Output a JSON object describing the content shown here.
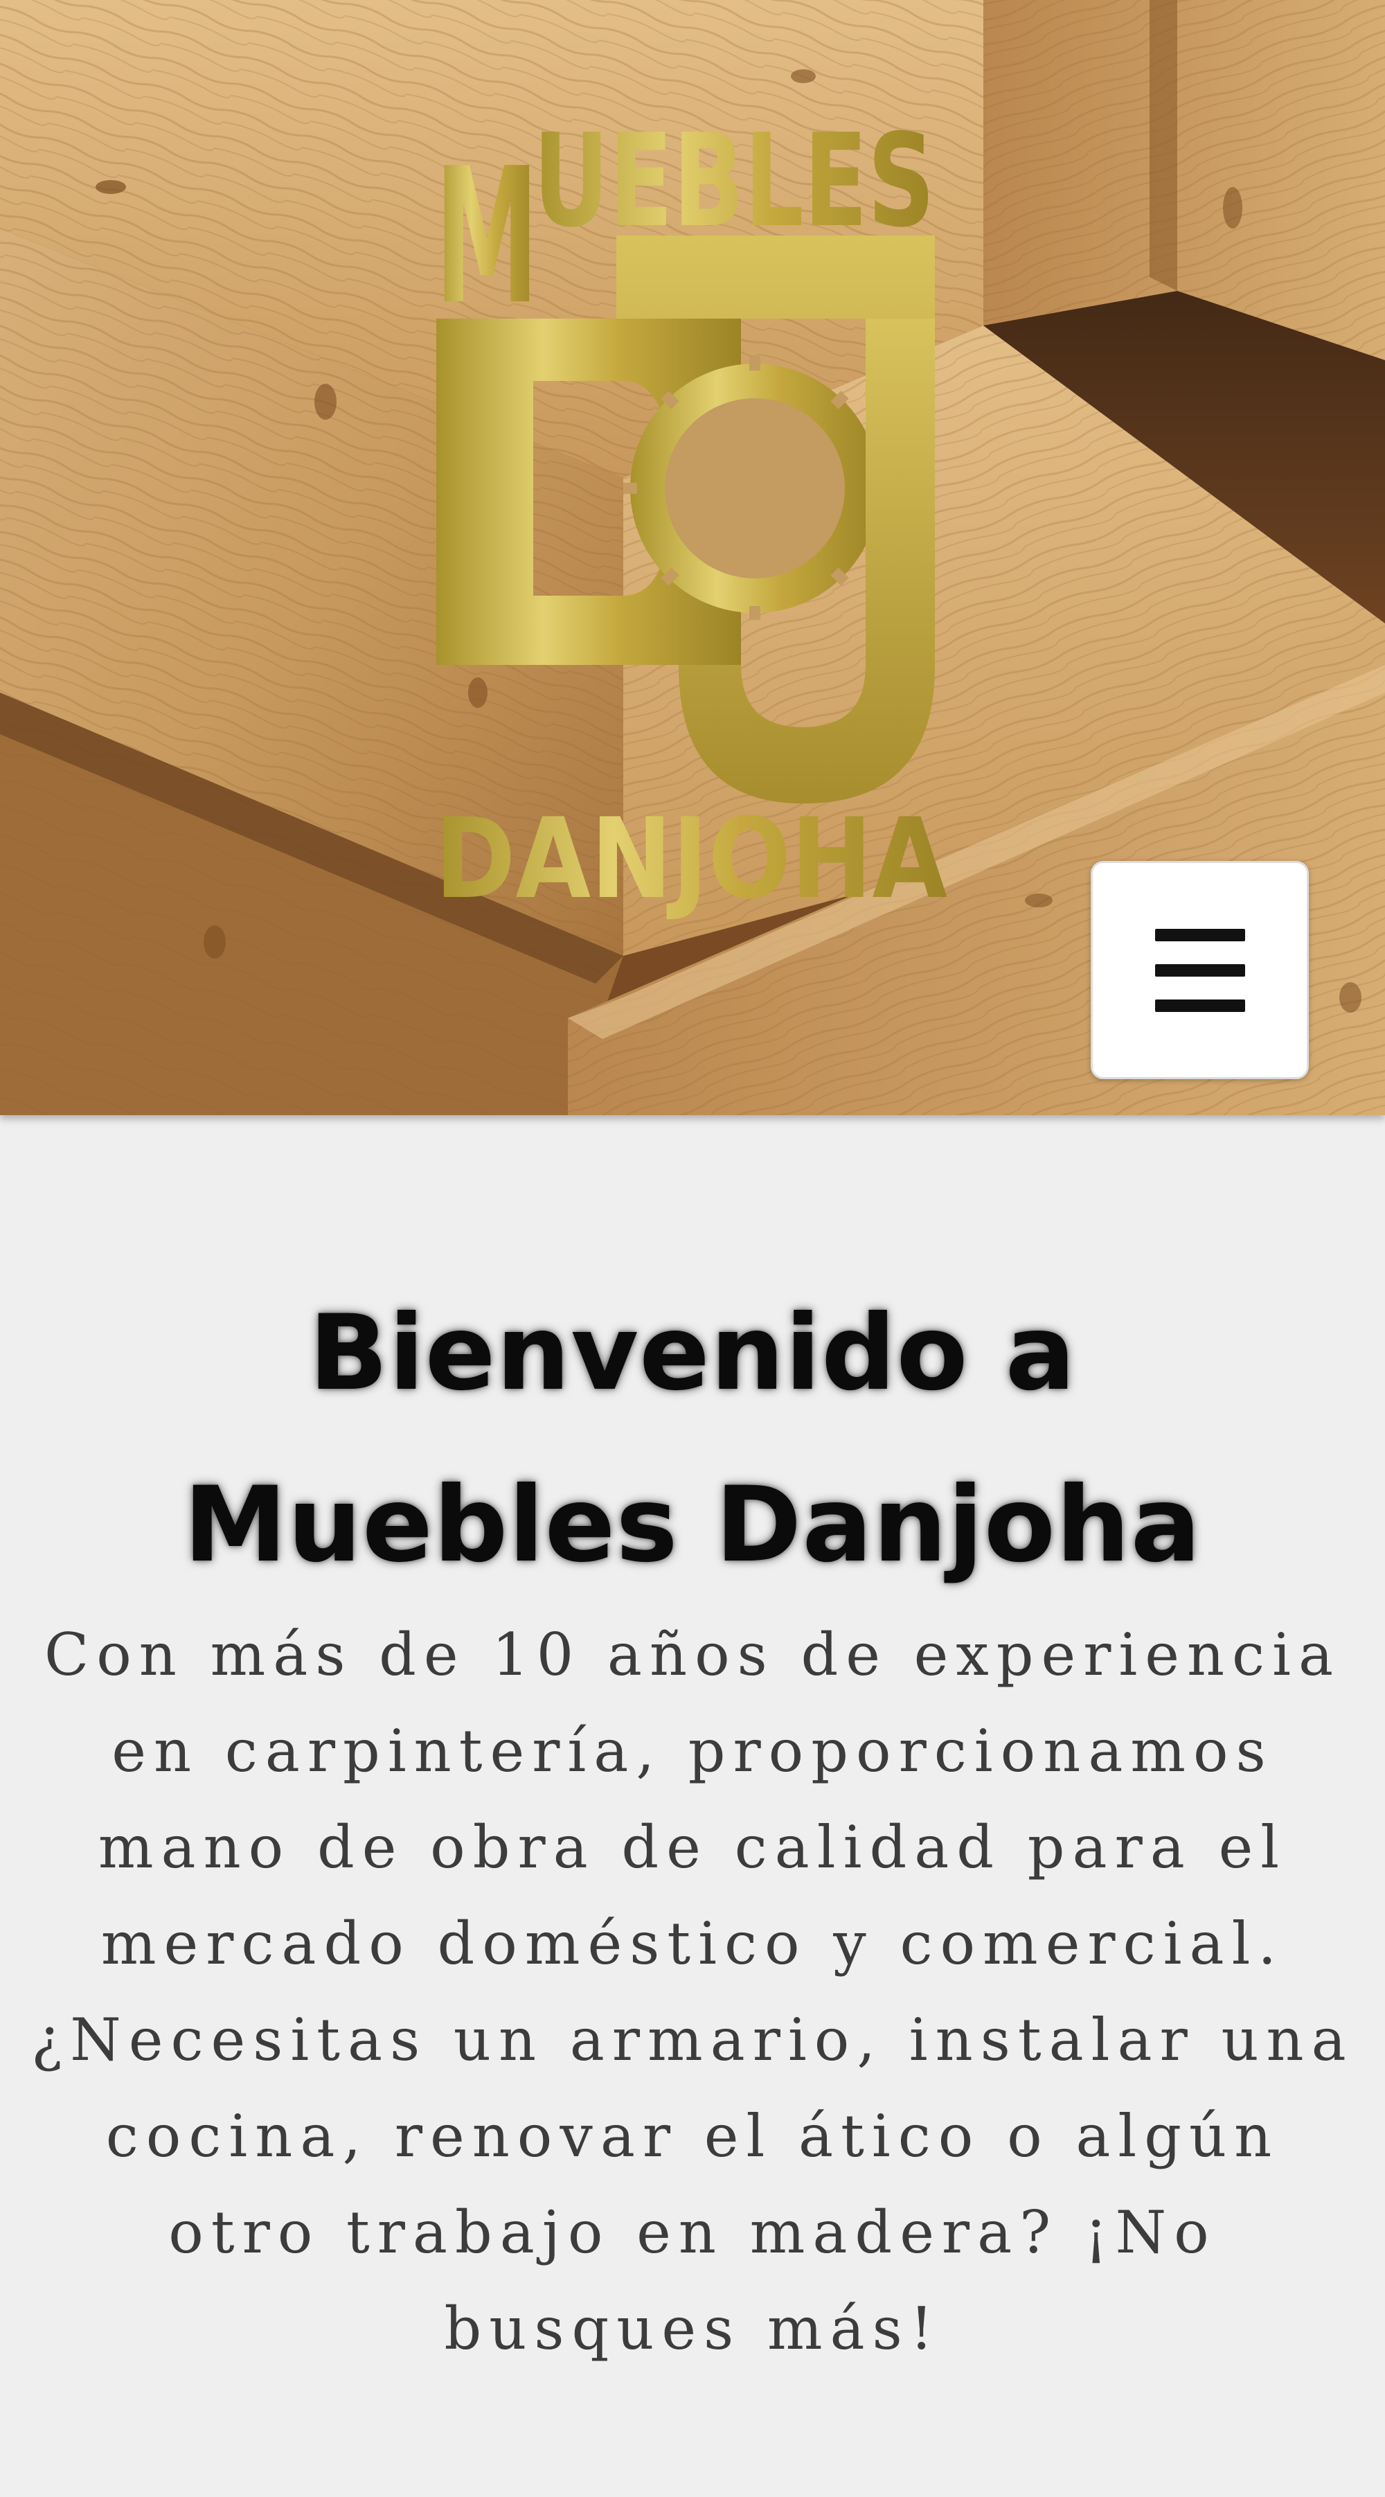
{
  "header": {
    "logo": {
      "top_text": "MUEBLES",
      "monogram": "DJ",
      "bottom_text": "DANJOHA",
      "color": "#c9b04a"
    },
    "menu_button": {
      "icon": "hamburger-menu-icon"
    }
  },
  "main": {
    "title": "Bienvenido a Muebles Danjoha",
    "paragraph": "Con más de 10 años de experiencia en carpintería, proporcionamos mano de obra de calidad para el mercado doméstico y comercial. ¿Necesitas un armario, instalar una cocina, renovar el ático o algún otro trabajo en madera? ¡No busques más!"
  },
  "colors": {
    "page_background": "#efefef",
    "title": "#0b0b0b",
    "body_text": "#3c3c3c",
    "wood": "#c8995f",
    "gold": "#c9b04a"
  }
}
